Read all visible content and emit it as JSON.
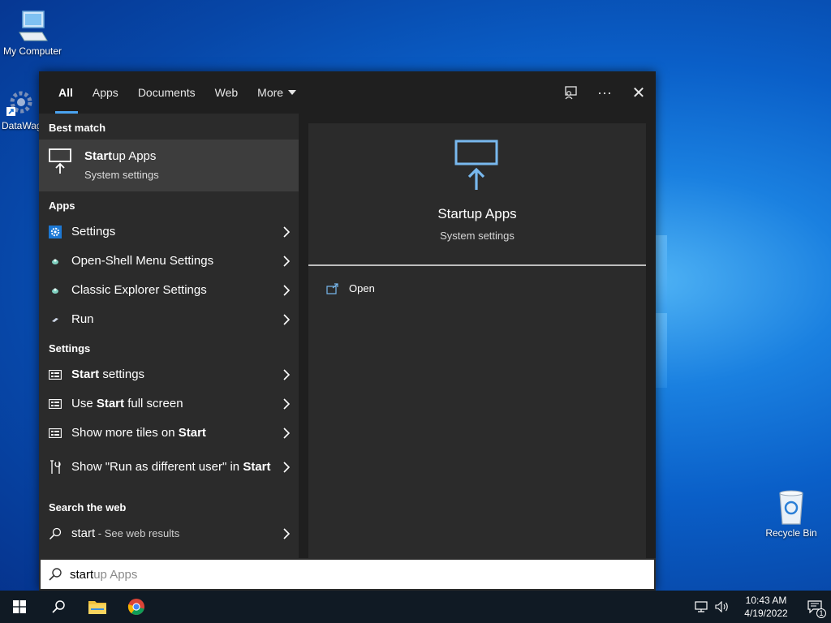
{
  "desktop": {
    "icons": [
      {
        "label": "My Computer"
      },
      {
        "label": "DataWag"
      },
      {
        "label": "Recycle Bin"
      }
    ]
  },
  "search": {
    "tabs": [
      {
        "label": "All",
        "active": true
      },
      {
        "label": "Apps"
      },
      {
        "label": "Documents"
      },
      {
        "label": "Web"
      },
      {
        "label": "More"
      }
    ],
    "top_actions": {
      "more_icon": "···",
      "close_icon": "✕"
    },
    "best_match": {
      "heading": "Best match",
      "title_bold": "Start",
      "title_rest": "up Apps",
      "subtitle": "System settings"
    },
    "apps": {
      "heading": "Apps",
      "items": [
        {
          "label": "Settings"
        },
        {
          "label": "Open-Shell Menu Settings"
        },
        {
          "label": "Classic Explorer Settings"
        },
        {
          "label": "Run"
        }
      ]
    },
    "settings": {
      "heading": "Settings",
      "items": [
        {
          "pre": "",
          "bold": "Start",
          "post": " settings"
        },
        {
          "pre": "Use ",
          "bold": "Start",
          "post": " full screen"
        },
        {
          "pre": "Show more tiles on ",
          "bold": "Start",
          "post": ""
        },
        {
          "pre": "Show \"Run as different user\" in ",
          "bold": "Start",
          "post": ""
        }
      ]
    },
    "web": {
      "heading": "Search the web",
      "query": "start",
      "suffix": " - See web results"
    },
    "preview": {
      "title": "Startup Apps",
      "subtitle": "System settings",
      "action": "Open"
    },
    "box": {
      "typed": "start",
      "ghost": "up Apps"
    },
    "accent": "#4aa3f0"
  },
  "taskbar": {
    "time": "10:43 AM",
    "date": "4/19/2022",
    "notification_count": "1"
  }
}
